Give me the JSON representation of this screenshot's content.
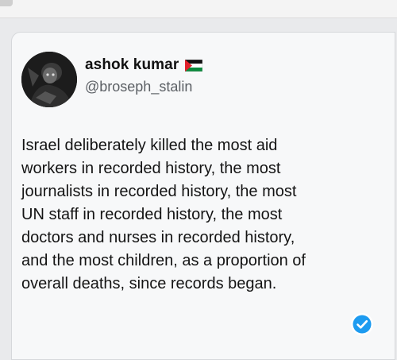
{
  "post": {
    "author": {
      "display_name": "ashok kumar",
      "handle": "@broseph_stalin",
      "name_icon": "palestine-flag-icon",
      "avatar_icon": "profile-photo"
    },
    "text": "Israel deliberately killed the most aid\nworkers in recorded history, the most\njournalists in recorded history, the most\nUN staff in recorded history, the most\ndoctors and nurses in recorded history,\nand the most children, as a proportion of\noverall deaths, since records began.",
    "badge_icon": "verified-check-icon"
  },
  "colors": {
    "card_bg": "#f7f8f9",
    "text": "#141414",
    "handle": "#5b5f64",
    "badge": "#1d9bf0"
  }
}
